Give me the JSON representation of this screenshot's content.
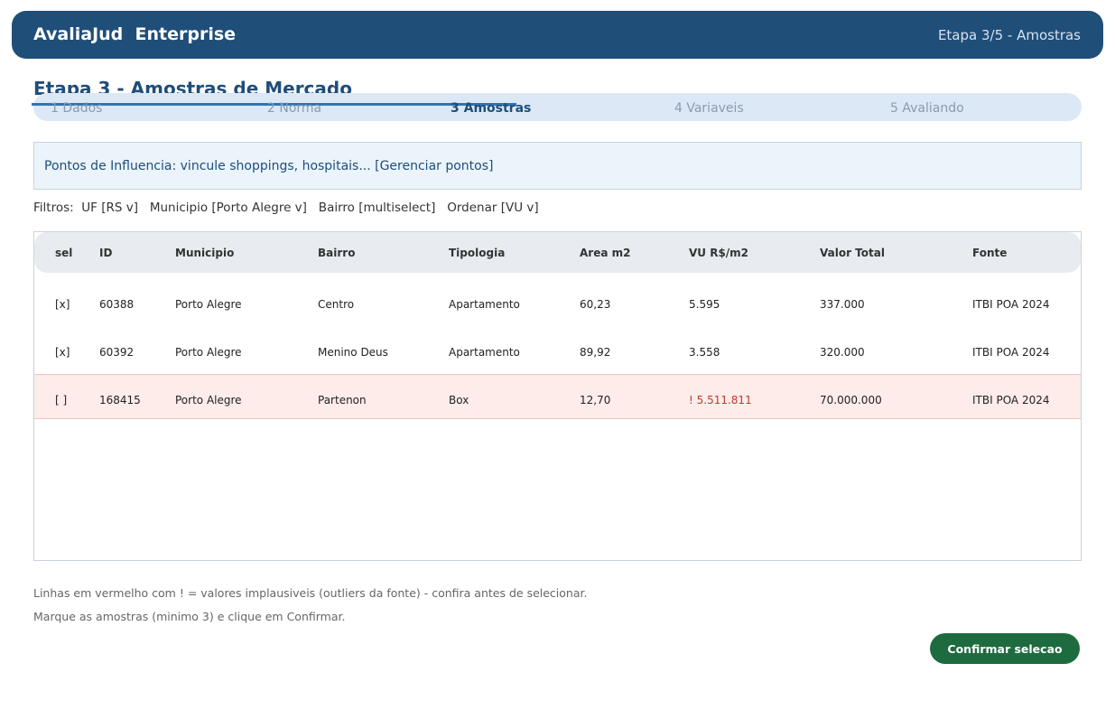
{
  "header": {
    "app_title": "AvaliaJud  Enterprise",
    "step_indicator": "Etapa 3/5 - Amostras"
  },
  "page_title": "Etapa 3 - Amostras de Mercado",
  "stepper": {
    "steps": [
      "1 Dados",
      "2 Norma",
      "3 Amostras",
      "4 Variaveis",
      "5 Avaliando"
    ],
    "active_index": 2
  },
  "influence": {
    "text": "Pontos de Influencia: vincule shoppings, hospitais... [Gerenciar pontos]"
  },
  "filters": {
    "text": "Filtros:  UF [RS v]   Municipio [Porto Alegre v]   Bairro [multiselect]   Ordenar [VU v]"
  },
  "table": {
    "headers": [
      "sel",
      "ID",
      "Municipio",
      "Bairro",
      "Tipologia",
      "Area m2",
      "VU R$/m2",
      "Valor Total",
      "Fonte"
    ],
    "rows": [
      {
        "sel": "[x]",
        "id": "60388",
        "municipio": "Porto Alegre",
        "bairro": "Centro",
        "tipologia": "Apartamento",
        "area": "60,23",
        "vu": "5.595",
        "valor": "337.000",
        "fonte": "ITBI POA 2024"
      },
      {
        "sel": "[x]",
        "id": "60392",
        "municipio": "Porto Alegre",
        "bairro": "Menino Deus",
        "tipologia": "Apartamento",
        "area": "89,92",
        "vu": "3.558",
        "valor": "320.000",
        "fonte": "ITBI POA 2024"
      },
      {
        "sel": "[ ]",
        "id": "168415",
        "municipio": "Porto Alegre",
        "bairro": "Partenon",
        "tipologia": "Box",
        "area": "12,70",
        "vu": "! 5.511.811",
        "valor": "70.000.000",
        "fonte": "ITBI POA 2024",
        "outlier": true
      }
    ]
  },
  "notes": {
    "line1": "Linhas em vermelho com ! = valores implausiveis (outliers da fonte) - confira antes de selecionar.",
    "line2": "Marque as amostras (minimo 3) e clique em Confirmar."
  },
  "confirm_button": "Confirmar selecao",
  "colors": {
    "header_bg": "#1f4e79",
    "accent": "#2e75b6",
    "outlier_bg": "#fdecea",
    "outlier_text": "#c0392b",
    "confirm_bg": "#1e6b3f"
  }
}
